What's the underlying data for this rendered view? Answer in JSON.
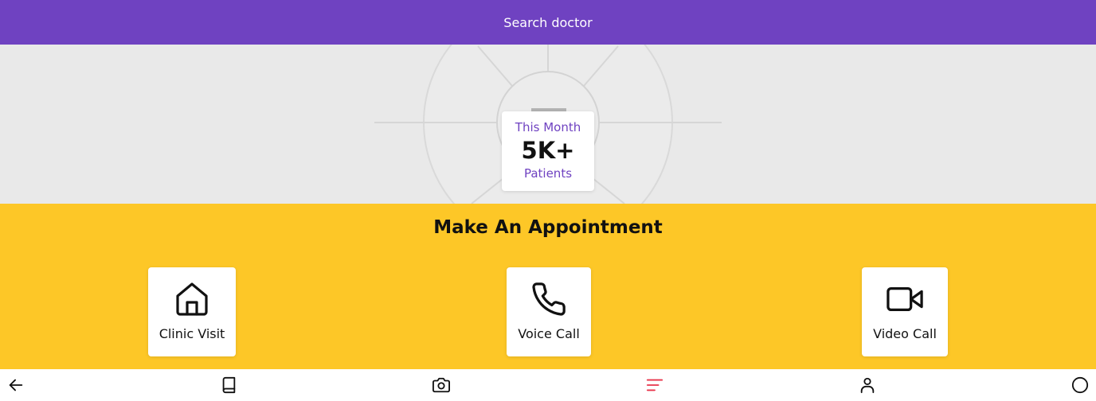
{
  "header": {
    "title": "Search doctor"
  },
  "stats": {
    "period": "This Month",
    "value": "5K+",
    "unit": "Patients"
  },
  "appointment": {
    "heading": "Make An Appointment",
    "options": [
      {
        "label": "Clinic Visit",
        "icon": "home-icon"
      },
      {
        "label": "Voice Call",
        "icon": "phone-icon"
      },
      {
        "label": "Video Call",
        "icon": "video-icon"
      }
    ]
  },
  "bottom_nav": {
    "items": [
      "back-arrow-icon",
      "book-icon",
      "camera-icon",
      "menu-icon",
      "user-icon",
      "circle-icon"
    ],
    "active": "menu-icon"
  },
  "colors": {
    "header": "#6f42c1",
    "hero_bg": "#e9e9e9",
    "appointment_bg": "#fdc727",
    "active_nav": "#e8334a"
  }
}
